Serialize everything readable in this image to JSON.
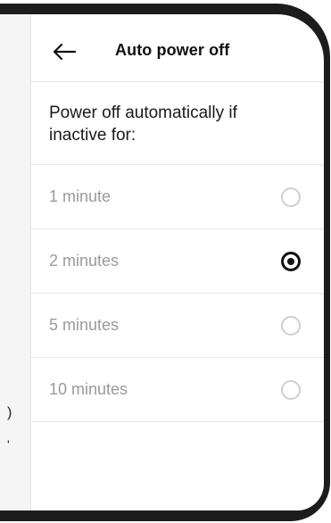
{
  "header": {
    "title": "Auto power off",
    "back_icon": "arrow-left-icon"
  },
  "intro": {
    "text": "Power off automatically if inactive for:"
  },
  "options": [
    {
      "label": "1 minute",
      "selected": false
    },
    {
      "label": "2 minutes",
      "selected": true
    },
    {
      "label": "5 minutes",
      "selected": false
    },
    {
      "label": "10 minutes",
      "selected": false
    }
  ],
  "behind": {
    "glyph_1": ")",
    "glyph_2": "'"
  },
  "colors": {
    "bezel": "#1c1c1c",
    "text_primary": "#111111",
    "text_muted": "#9a9a9a",
    "divider": "#e6e6e6",
    "radio_unselected": "#cfcfcf",
    "radio_selected": "#111111"
  }
}
